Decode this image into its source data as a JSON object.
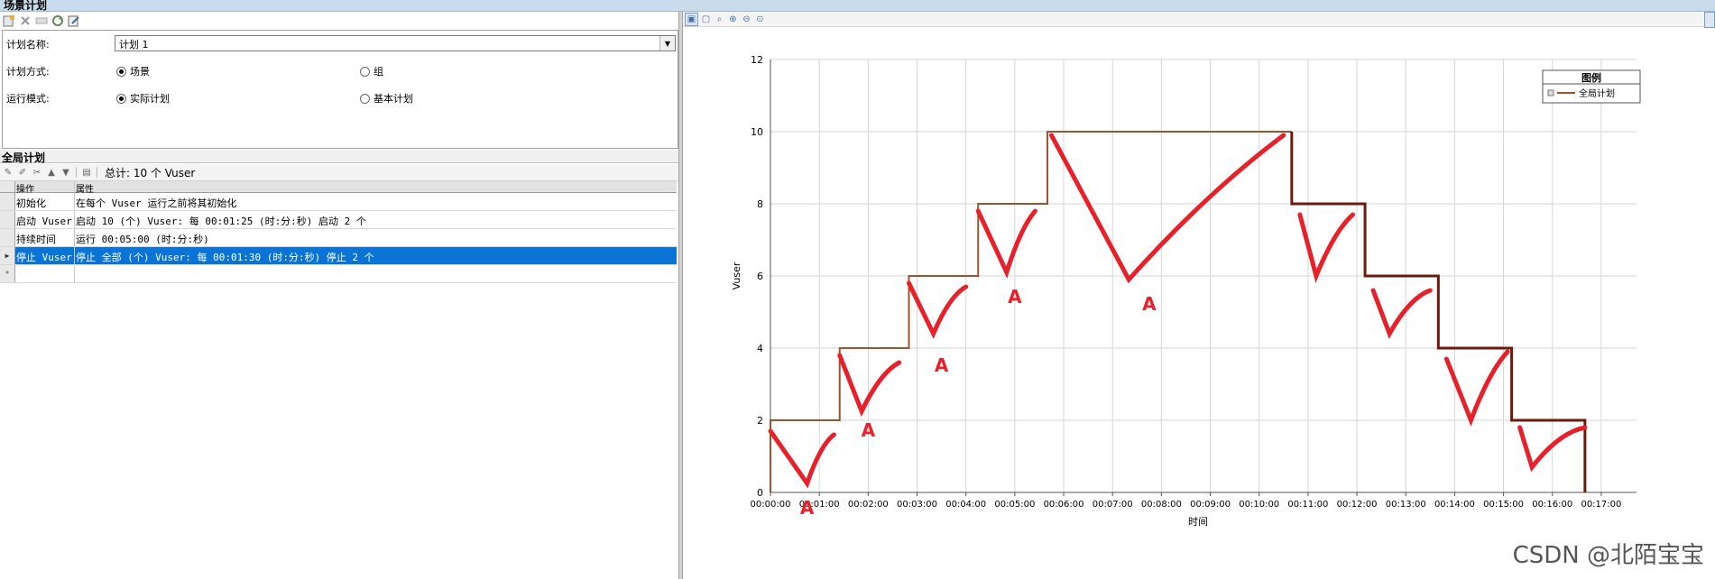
{
  "window": {
    "title": "场景计划"
  },
  "plan_panel": {
    "name_label": "计划名称:",
    "name_value": "计划 1",
    "mode_label": "计划方式:",
    "mode_options": [
      "场景",
      "组"
    ],
    "mode_selected": "场景",
    "run_label": "运行模式:",
    "run_options": [
      "实际计划",
      "基本计划"
    ],
    "run_selected": "实际计划"
  },
  "global_plan": {
    "title": "全局计划",
    "total": "总计: 10 个 Vuser",
    "columns": [
      "操作",
      "属性"
    ],
    "rows": [
      {
        "op": "初始化",
        "prop": "在每个 Vuser 运行之前将其初始化",
        "selected": false
      },
      {
        "op": "启动 Vuser",
        "prop": "启动 10 (个) Vuser: 每 00:01:25 (时:分:秒) 启动 2 个",
        "selected": false
      },
      {
        "op": "持续时间",
        "prop": "运行 00:05:00 (时:分:秒)",
        "selected": false
      },
      {
        "op": "停止 Vuser",
        "prop": "停止 全部 (个) Vuser: 每 00:01:30 (时:分:秒) 停止 2 个",
        "selected": true
      }
    ]
  },
  "chart_data": {
    "type": "line",
    "xlabel": "时间",
    "ylabel": "Vuser",
    "ylim": [
      0,
      12
    ],
    "yticks": [
      0,
      2,
      4,
      6,
      8,
      10,
      12
    ],
    "xticks": [
      "00:00:00",
      "00:01:00",
      "00:02:00",
      "00:03:00",
      "00:04:00",
      "00:05:00",
      "00:06:00",
      "00:07:00",
      "00:08:00",
      "00:09:00",
      "00:10:00",
      "00:11:00",
      "00:12:00",
      "00:13:00",
      "00:14:00",
      "00:15:00",
      "00:16:00",
      "00:17:00"
    ],
    "xlim_seconds": [
      0,
      1050
    ],
    "grid": true,
    "legend": {
      "title": "图例",
      "placement": "top-right",
      "entries": [
        "全局计划"
      ]
    },
    "series": [
      {
        "name": "全局计划",
        "color": "#a0522d",
        "points_ramp_up": [
          [
            0,
            0
          ],
          [
            0,
            2
          ],
          [
            85,
            2
          ],
          [
            85,
            4
          ],
          [
            170,
            4
          ],
          [
            170,
            6
          ],
          [
            255,
            6
          ],
          [
            255,
            8
          ],
          [
            340,
            8
          ],
          [
            340,
            10
          ],
          [
            640,
            10
          ]
        ],
        "points_ramp_down": [
          [
            640,
            10
          ],
          [
            640,
            8
          ],
          [
            730,
            8
          ],
          [
            730,
            6
          ],
          [
            820,
            6
          ],
          [
            820,
            4
          ],
          [
            910,
            4
          ],
          [
            910,
            2
          ],
          [
            1000,
            2
          ],
          [
            1000,
            0
          ]
        ],
        "ramp_down_color": "#6b1a0e"
      }
    ],
    "annotations": [
      {
        "text": "A",
        "x": 45,
        "y": -0.4
      },
      {
        "text": "A",
        "x": 120,
        "y": 1.75
      },
      {
        "text": "A",
        "x": 210,
        "y": 3.55
      },
      {
        "text": "A",
        "x": 300,
        "y": 5.45
      },
      {
        "text": "A",
        "x": 465,
        "y": 5.25
      }
    ],
    "annotation_color": "#e8202a"
  },
  "watermark": "CSDN @北陌宝宝"
}
